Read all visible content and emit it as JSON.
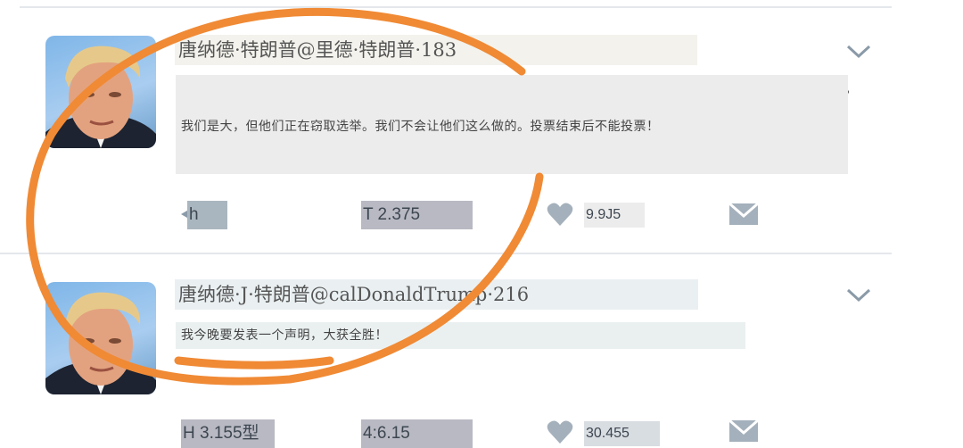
{
  "colors": {
    "annotation_circle": "#f08a35",
    "action_icon": "#8a9aa8",
    "header_bg_1": "#f3f2ec",
    "header_bg_2": "#eaf0f2"
  },
  "tweets": [
    {
      "header": "唐纳德·特朗普@里德·特朗普·183",
      "text": "我们是大，但他们正在窃取选举。我们不会让他们这么做的。投票结束后不能投票！",
      "actions": {
        "reply": "h",
        "retweet": "T 2.375",
        "like": "9.9J5"
      },
      "icons": [
        "chevron-down-icon",
        "reply-icon",
        "heart-icon",
        "mail-icon"
      ]
    },
    {
      "header": "唐纳德·J·特朗普@calDonaldTrump·216",
      "text": "我今晚要发表一个声明，大获全胜！",
      "actions": {
        "reply": "H 3.155型",
        "retweet": "4:6.15",
        "like": "30.455"
      },
      "icons": [
        "chevron-down-icon",
        "heart-icon",
        "mail-icon"
      ]
    }
  ]
}
